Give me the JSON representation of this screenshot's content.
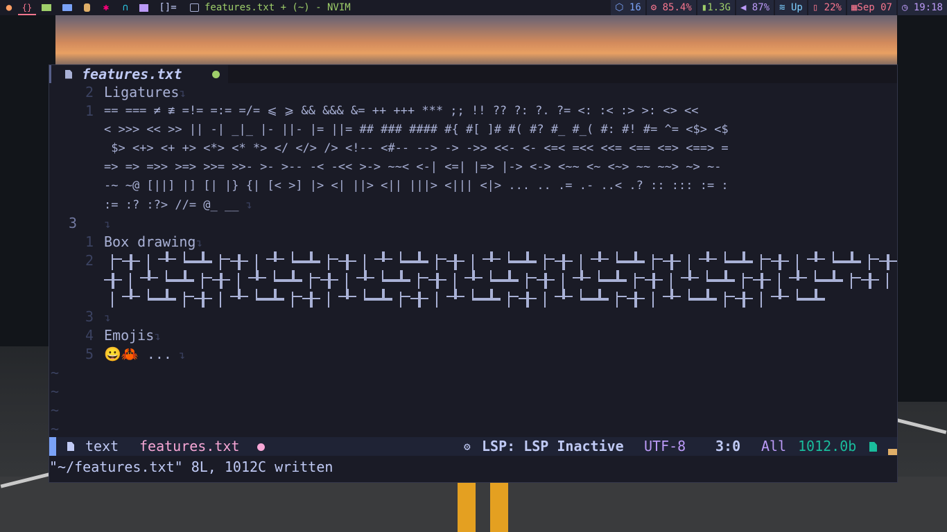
{
  "topbar": {
    "workspaces": [
      {
        "icon": "firefox-icon",
        "color": "#ff9e64",
        "label": ""
      },
      {
        "icon": "braces-icon",
        "color": "#f7768e",
        "label": "{}"
      },
      {
        "icon": "terminal-icon",
        "color": "#9ece6a",
        "label": ""
      },
      {
        "icon": "folder-icon",
        "color": "#7aa2f7",
        "label": ""
      },
      {
        "icon": "database-icon",
        "color": "#e0af68",
        "label": ""
      },
      {
        "icon": "gear-icon",
        "color": "#ff007c",
        "label": ""
      },
      {
        "icon": "headphones-icon",
        "color": "#2ac3de",
        "label": ""
      },
      {
        "icon": "image-icon",
        "color": "#bb9af7",
        "label": ""
      }
    ],
    "layout": "[]=",
    "window_title": "features.txt + (~) - NVIM",
    "modules": [
      {
        "icon": "cube-icon",
        "text": "16",
        "color": "#7aa2f7"
      },
      {
        "icon": "cpu-icon",
        "text": "85.4%",
        "color": "#f7768e"
      },
      {
        "icon": "memory-icon",
        "text": "1.3G",
        "color": "#9ece6a"
      },
      {
        "icon": "volume-icon",
        "text": "87%",
        "color": "#bb9af7"
      },
      {
        "icon": "wifi-icon",
        "text": "Up",
        "color": "#7dcfff"
      },
      {
        "icon": "battery-icon",
        "text": "22%",
        "color": "#f7768e"
      },
      {
        "icon": "calendar-icon",
        "text": "Sep 07",
        "color": "#f7768e"
      },
      {
        "icon": "clock-icon",
        "text": "19:18",
        "color": "#bb9af7"
      }
    ]
  },
  "editor": {
    "tab": {
      "filename": "features.txt",
      "modified_color": "#9ece6a"
    },
    "lines": [
      {
        "num": "2",
        "text": "Ligatures"
      },
      {
        "num": "1",
        "text": "== === ≠ ≢ =!= =:= =/= ⩽ ⩾ && &&& &= ++ +++ *** ;; !! ?? ?: ?. ?= <: :< :> >: <> <<"
      },
      {
        "num": "",
        "text": "< >>> << >> || -| _|_ |- ||- |= ||= ## ### #### #{ #[ ]# #( #? #_ #_( #: #! #= ^= <$> <$"
      },
      {
        "num": "",
        "text": " $> <+> <+ +> <*> <* *> </ </> /> <!-- <#-- --> -> ->> <<- <- <=< =<< <<= <== <=> <==> ="
      },
      {
        "num": "",
        "text": "=> => =>> >=> >>= >>- >- >-- -< -<< >-> ~~< <-| <=| |=> |-> <-> <~~ <~ <~> ~~ ~~> ~> ~-"
      },
      {
        "num": "",
        "text": "-~ ~@ [||] |] [| |} {| [< >] |> <| ||> <|| |||> <||| <|> ... .. .= .- ..< .? :: ::: := :"
      },
      {
        "num": "",
        "text": ":= :? :?> //= @_ __"
      },
      {
        "num": "3",
        "text": ""
      },
      {
        "num": "1",
        "text": "Box drawing"
      },
      {
        "num": "2",
        "text": ""
      },
      {
        "num": "",
        "text": ""
      },
      {
        "num": "",
        "text": ""
      },
      {
        "num": "3",
        "text": ""
      },
      {
        "num": "4",
        "text": "Emojis"
      },
      {
        "num": "5",
        "text": "😀🦀 ..."
      }
    ],
    "current_line_num": "3"
  },
  "statusline": {
    "filetype": "text",
    "filename": "features.txt",
    "lsp": "LSP: LSP Inactive",
    "encoding": "UTF-8",
    "position": "3:0",
    "scroll": "All",
    "size": "1012.0b"
  },
  "cmdline": "\"~/features.txt\" 8L, 1012C written"
}
